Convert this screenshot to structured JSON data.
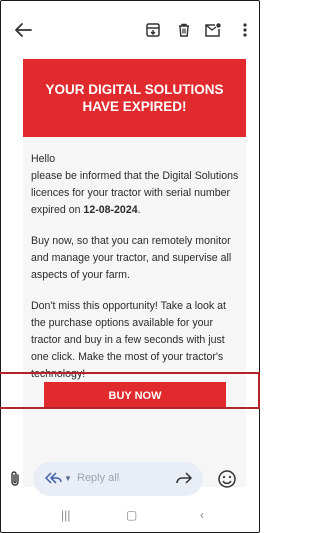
{
  "banner": {
    "title": "YOUR DIGITAL SOLUTIONS HAVE EXPIRED!"
  },
  "email": {
    "greeting": "Hello",
    "p1_pre": "please be informed that the Digital Solutions licences for your tractor with serial number expired on ",
    "p1_date": "12-08-2024",
    "p1_post": ".",
    "p2": "Buy now, so that you can remotely monitor and manage your tractor, and supervise all aspects of your farm.",
    "p3": "Don't miss this opportunity! Take a look at the purchase options available for your tractor and buy in a few seconds with just one click. Make the most of your tractor's technology!",
    "cta": "BUY NOW"
  },
  "reply": {
    "placeholder": "Reply all"
  },
  "colors": {
    "brand_red": "#e12a2d",
    "highlight": "#b3232a",
    "reply_bg": "#e9eef6"
  },
  "icons": {
    "back": "arrow-left-icon",
    "archive": "archive-icon",
    "delete": "trash-icon",
    "unread": "mark-unread-icon",
    "more": "more-vert-icon",
    "attach": "paperclip-icon",
    "reply_all": "reply-all-icon",
    "forward": "forward-icon",
    "emoji": "emoji-icon"
  }
}
